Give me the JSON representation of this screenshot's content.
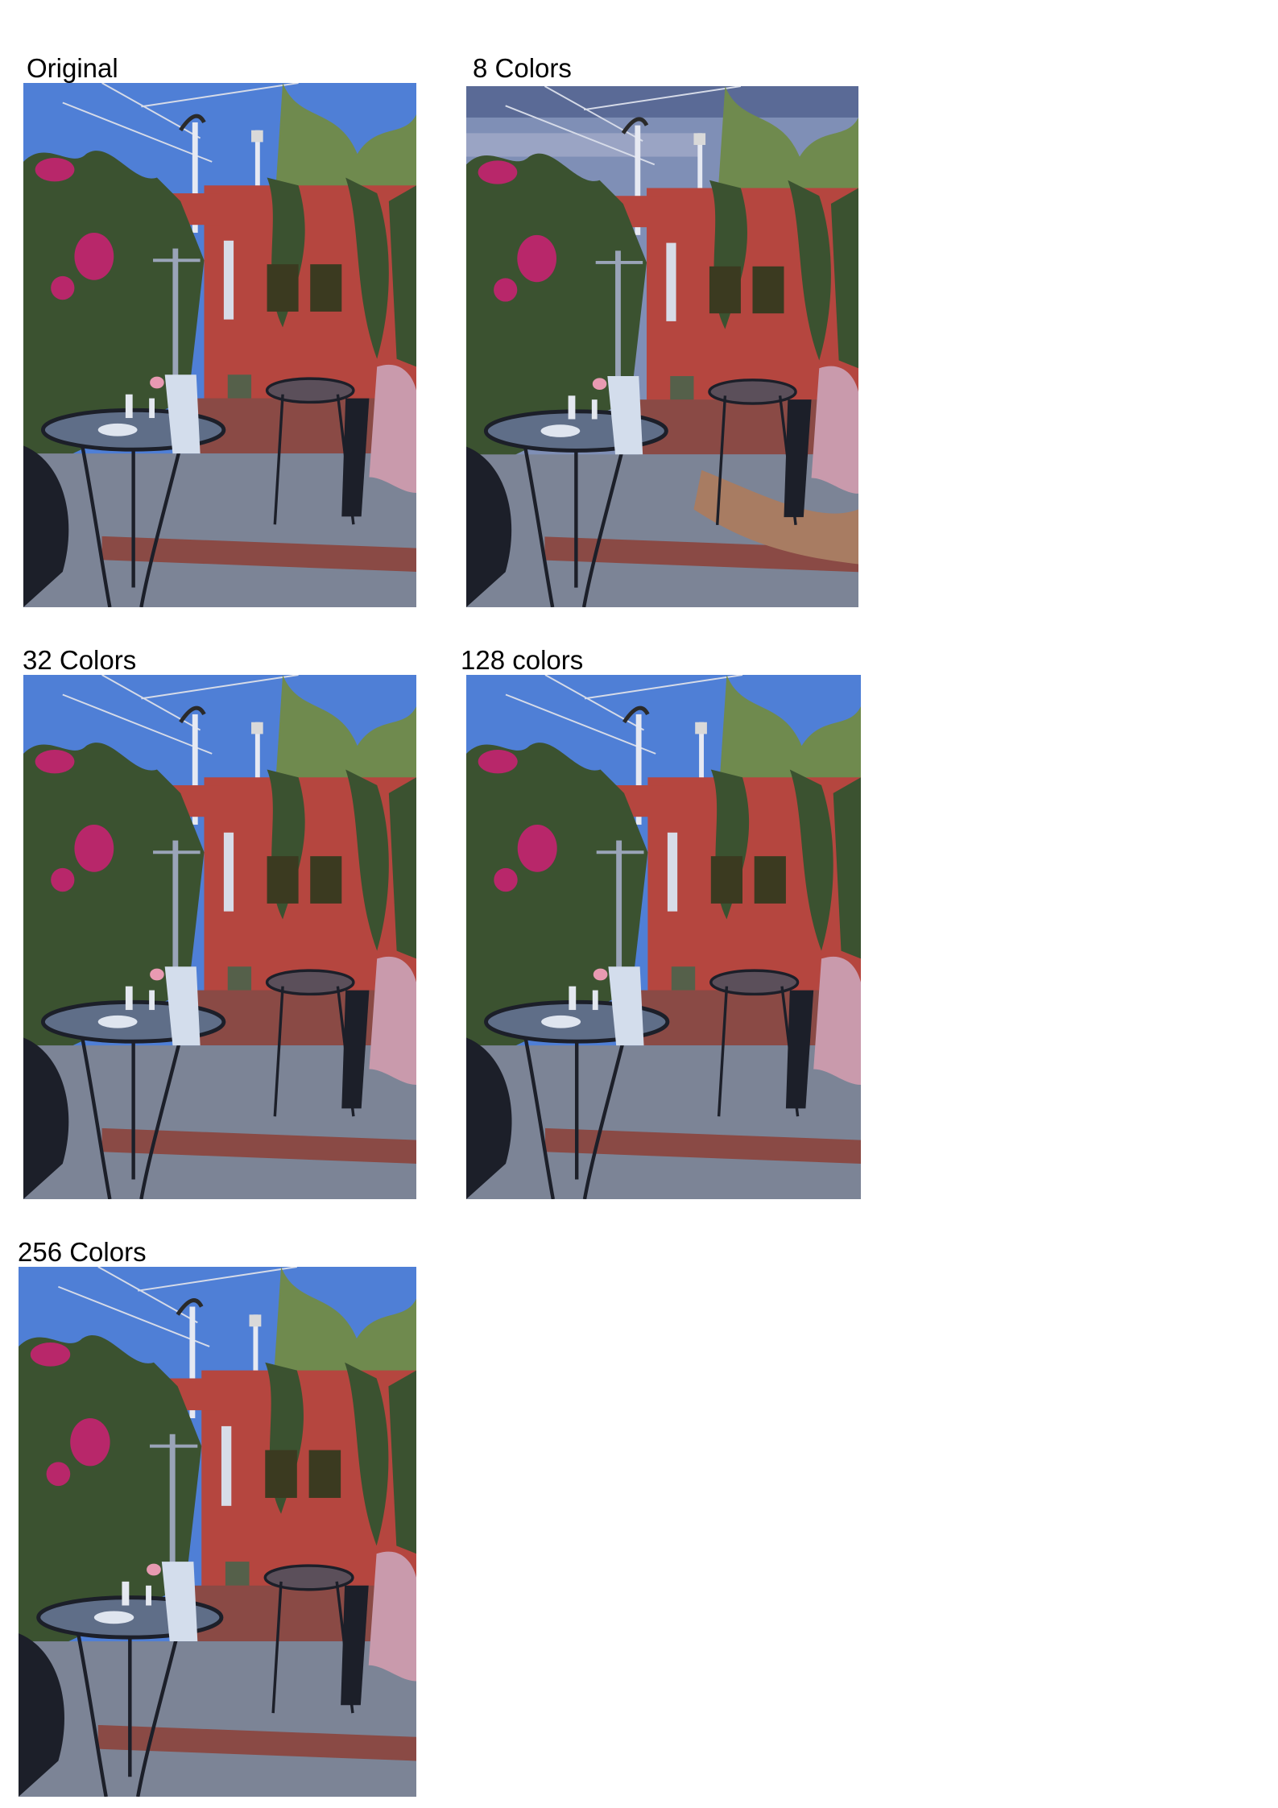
{
  "panels": [
    {
      "caption": "Original",
      "palette": "original"
    },
    {
      "caption": "8 Colors",
      "palette": "8-colors"
    },
    {
      "caption": "32 Colors",
      "palette": "32-colors"
    },
    {
      "caption": "128 colors",
      "palette": "128-colors"
    },
    {
      "caption": "256 Colors",
      "palette": "256-colors"
    }
  ],
  "colors": {
    "sky": "#4f7fd6",
    "sky_8": "#7f8fb6",
    "wall": "#b5463f",
    "foliage": "#3b5230",
    "flowers": "#b8276a",
    "ground": "#7c8496",
    "bricks": "#8a4a45",
    "furniture": "#1c1f29",
    "throw": "#c99aac"
  }
}
